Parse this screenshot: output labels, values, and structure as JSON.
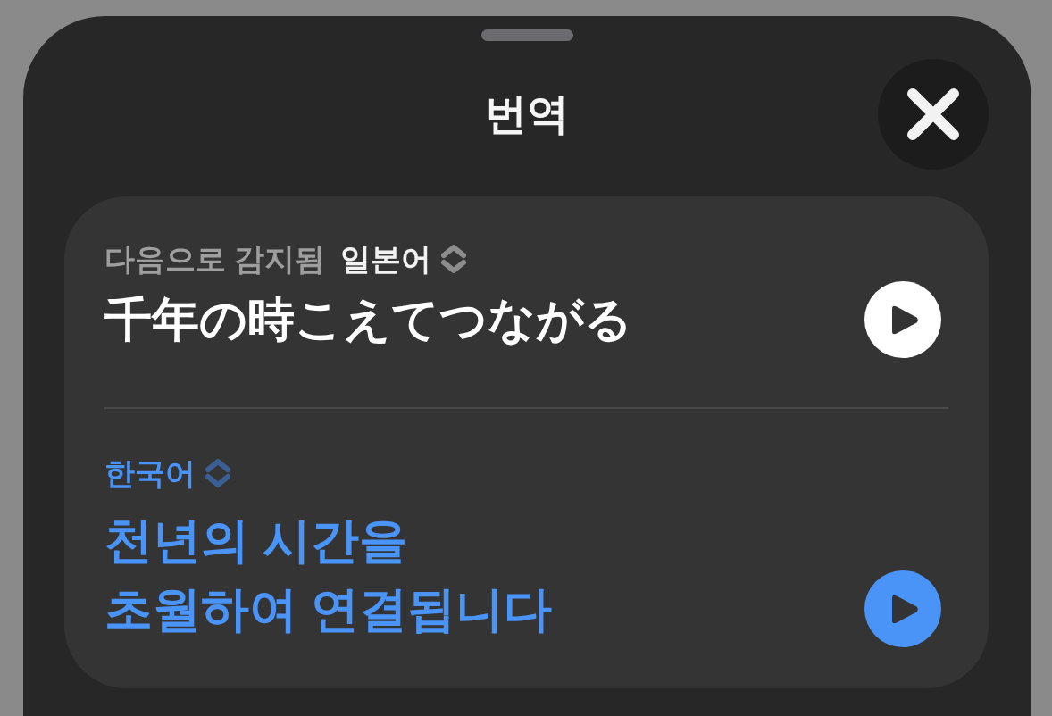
{
  "sheet": {
    "title": "번역"
  },
  "sections": [
    {
      "kind": "source",
      "detected_label": "다음으로 감지됨",
      "language": "일본어",
      "text": "千年の時こえてつながる"
    },
    {
      "kind": "target",
      "language": "한국어",
      "text": "천년의 시간을\n초월하여 연결됩니다"
    }
  ]
}
